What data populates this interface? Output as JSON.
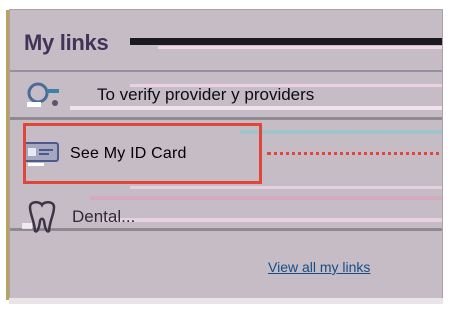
{
  "panel": {
    "title": "My links",
    "links": [
      {
        "label": "To verify provider y providers",
        "icon": "provider-map-icon"
      },
      {
        "label": "See My ID Card",
        "icon": "id-card-icon"
      },
      {
        "label": "Dental...",
        "icon": "tooth-icon"
      }
    ],
    "footer_link": "View all my links"
  },
  "colors": {
    "panel_background": "#c5bcc5",
    "highlight": "#e0473a",
    "title": "#3f3558",
    "link": "#174d86"
  }
}
